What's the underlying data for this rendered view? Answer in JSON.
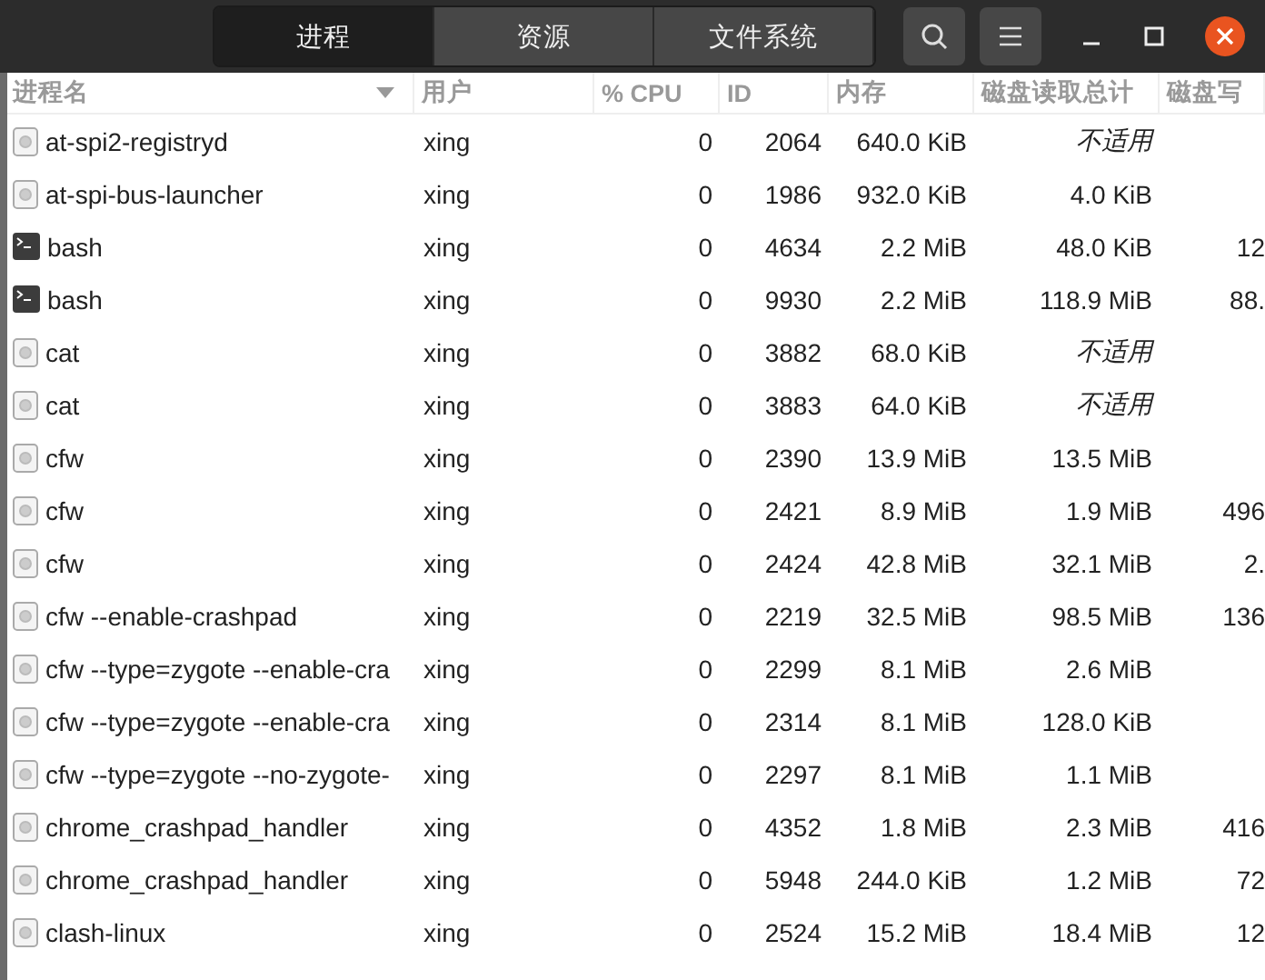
{
  "tabs": [
    {
      "label": "进程",
      "selected": true
    },
    {
      "label": "资源",
      "selected": false
    },
    {
      "label": "文件系统",
      "selected": false
    }
  ],
  "table": {
    "columns": [
      {
        "label": "进程名",
        "sorted": true
      },
      {
        "label": "用户",
        "sorted": false
      },
      {
        "label": "% CPU",
        "sorted": false
      },
      {
        "label": "ID",
        "sorted": false
      },
      {
        "label": "内存",
        "sorted": false
      },
      {
        "label": "磁盘读取总计",
        "sorted": false
      },
      {
        "label": "磁盘写",
        "sorted": false
      }
    ],
    "rows": [
      {
        "kind": "service",
        "name": "at-spi2-registryd",
        "user": "xing",
        "cpu": "0",
        "id": "2064",
        "memory": "640.0 KiB",
        "disk_read": "不适用",
        "disk_read_na": true
      },
      {
        "kind": "service",
        "name": "at-spi-bus-launcher",
        "user": "xing",
        "cpu": "0",
        "id": "1986",
        "memory": "932.0 KiB",
        "disk_read": "4.0 KiB",
        "disk_read_na": false
      },
      {
        "kind": "shell",
        "name": "bash",
        "user": "xing",
        "cpu": "0",
        "id": "4634",
        "memory": "2.2 MiB",
        "disk_read": "48.0 KiB",
        "disk_read_na": false,
        "disk_write": "12"
      },
      {
        "kind": "shell",
        "name": "bash",
        "user": "xing",
        "cpu": "0",
        "id": "9930",
        "memory": "2.2 MiB",
        "disk_read": "118.9 MiB",
        "disk_read_na": false,
        "disk_write": "88."
      },
      {
        "kind": "service",
        "name": "cat",
        "user": "xing",
        "cpu": "0",
        "id": "3882",
        "memory": "68.0 KiB",
        "disk_read": "不适用",
        "disk_read_na": true
      },
      {
        "kind": "service",
        "name": "cat",
        "user": "xing",
        "cpu": "0",
        "id": "3883",
        "memory": "64.0 KiB",
        "disk_read": "不适用",
        "disk_read_na": true
      },
      {
        "kind": "service",
        "name": "cfw",
        "user": "xing",
        "cpu": "0",
        "id": "2390",
        "memory": "13.9 MiB",
        "disk_read": "13.5 MiB",
        "disk_read_na": false
      },
      {
        "kind": "service",
        "name": "cfw",
        "user": "xing",
        "cpu": "0",
        "id": "2421",
        "memory": "8.9 MiB",
        "disk_read": "1.9 MiB",
        "disk_read_na": false,
        "disk_write": "496"
      },
      {
        "kind": "service",
        "name": "cfw",
        "user": "xing",
        "cpu": "0",
        "id": "2424",
        "memory": "42.8 MiB",
        "disk_read": "32.1 MiB",
        "disk_read_na": false,
        "disk_write": "2."
      },
      {
        "kind": "service",
        "name": "cfw --enable-crashpad",
        "user": "xing",
        "cpu": "0",
        "id": "2219",
        "memory": "32.5 MiB",
        "disk_read": "98.5 MiB",
        "disk_read_na": false,
        "disk_write": "136"
      },
      {
        "kind": "service",
        "name": "cfw --type=zygote --enable-cra",
        "user": "xing",
        "cpu": "0",
        "id": "2299",
        "memory": "8.1 MiB",
        "disk_read": "2.6 MiB",
        "disk_read_na": false
      },
      {
        "kind": "service",
        "name": "cfw --type=zygote --enable-cra",
        "user": "xing",
        "cpu": "0",
        "id": "2314",
        "memory": "8.1 MiB",
        "disk_read": "128.0 KiB",
        "disk_read_na": false
      },
      {
        "kind": "service",
        "name": "cfw --type=zygote --no-zygote-",
        "user": "xing",
        "cpu": "0",
        "id": "2297",
        "memory": "8.1 MiB",
        "disk_read": "1.1 MiB",
        "disk_read_na": false
      },
      {
        "kind": "service",
        "name": "chrome_crashpad_handler",
        "user": "xing",
        "cpu": "0",
        "id": "4352",
        "memory": "1.8 MiB",
        "disk_read": "2.3 MiB",
        "disk_read_na": false,
        "disk_write": "416"
      },
      {
        "kind": "service",
        "name": "chrome_crashpad_handler",
        "user": "xing",
        "cpu": "0",
        "id": "5948",
        "memory": "244.0 KiB",
        "disk_read": "1.2 MiB",
        "disk_read_na": false,
        "disk_write": "72"
      },
      {
        "kind": "service",
        "name": "clash-linux",
        "user": "xing",
        "cpu": "0",
        "id": "2524",
        "memory": "15.2 MiB",
        "disk_read": "18.4 MiB",
        "disk_read_na": false,
        "disk_write": "12"
      }
    ]
  }
}
